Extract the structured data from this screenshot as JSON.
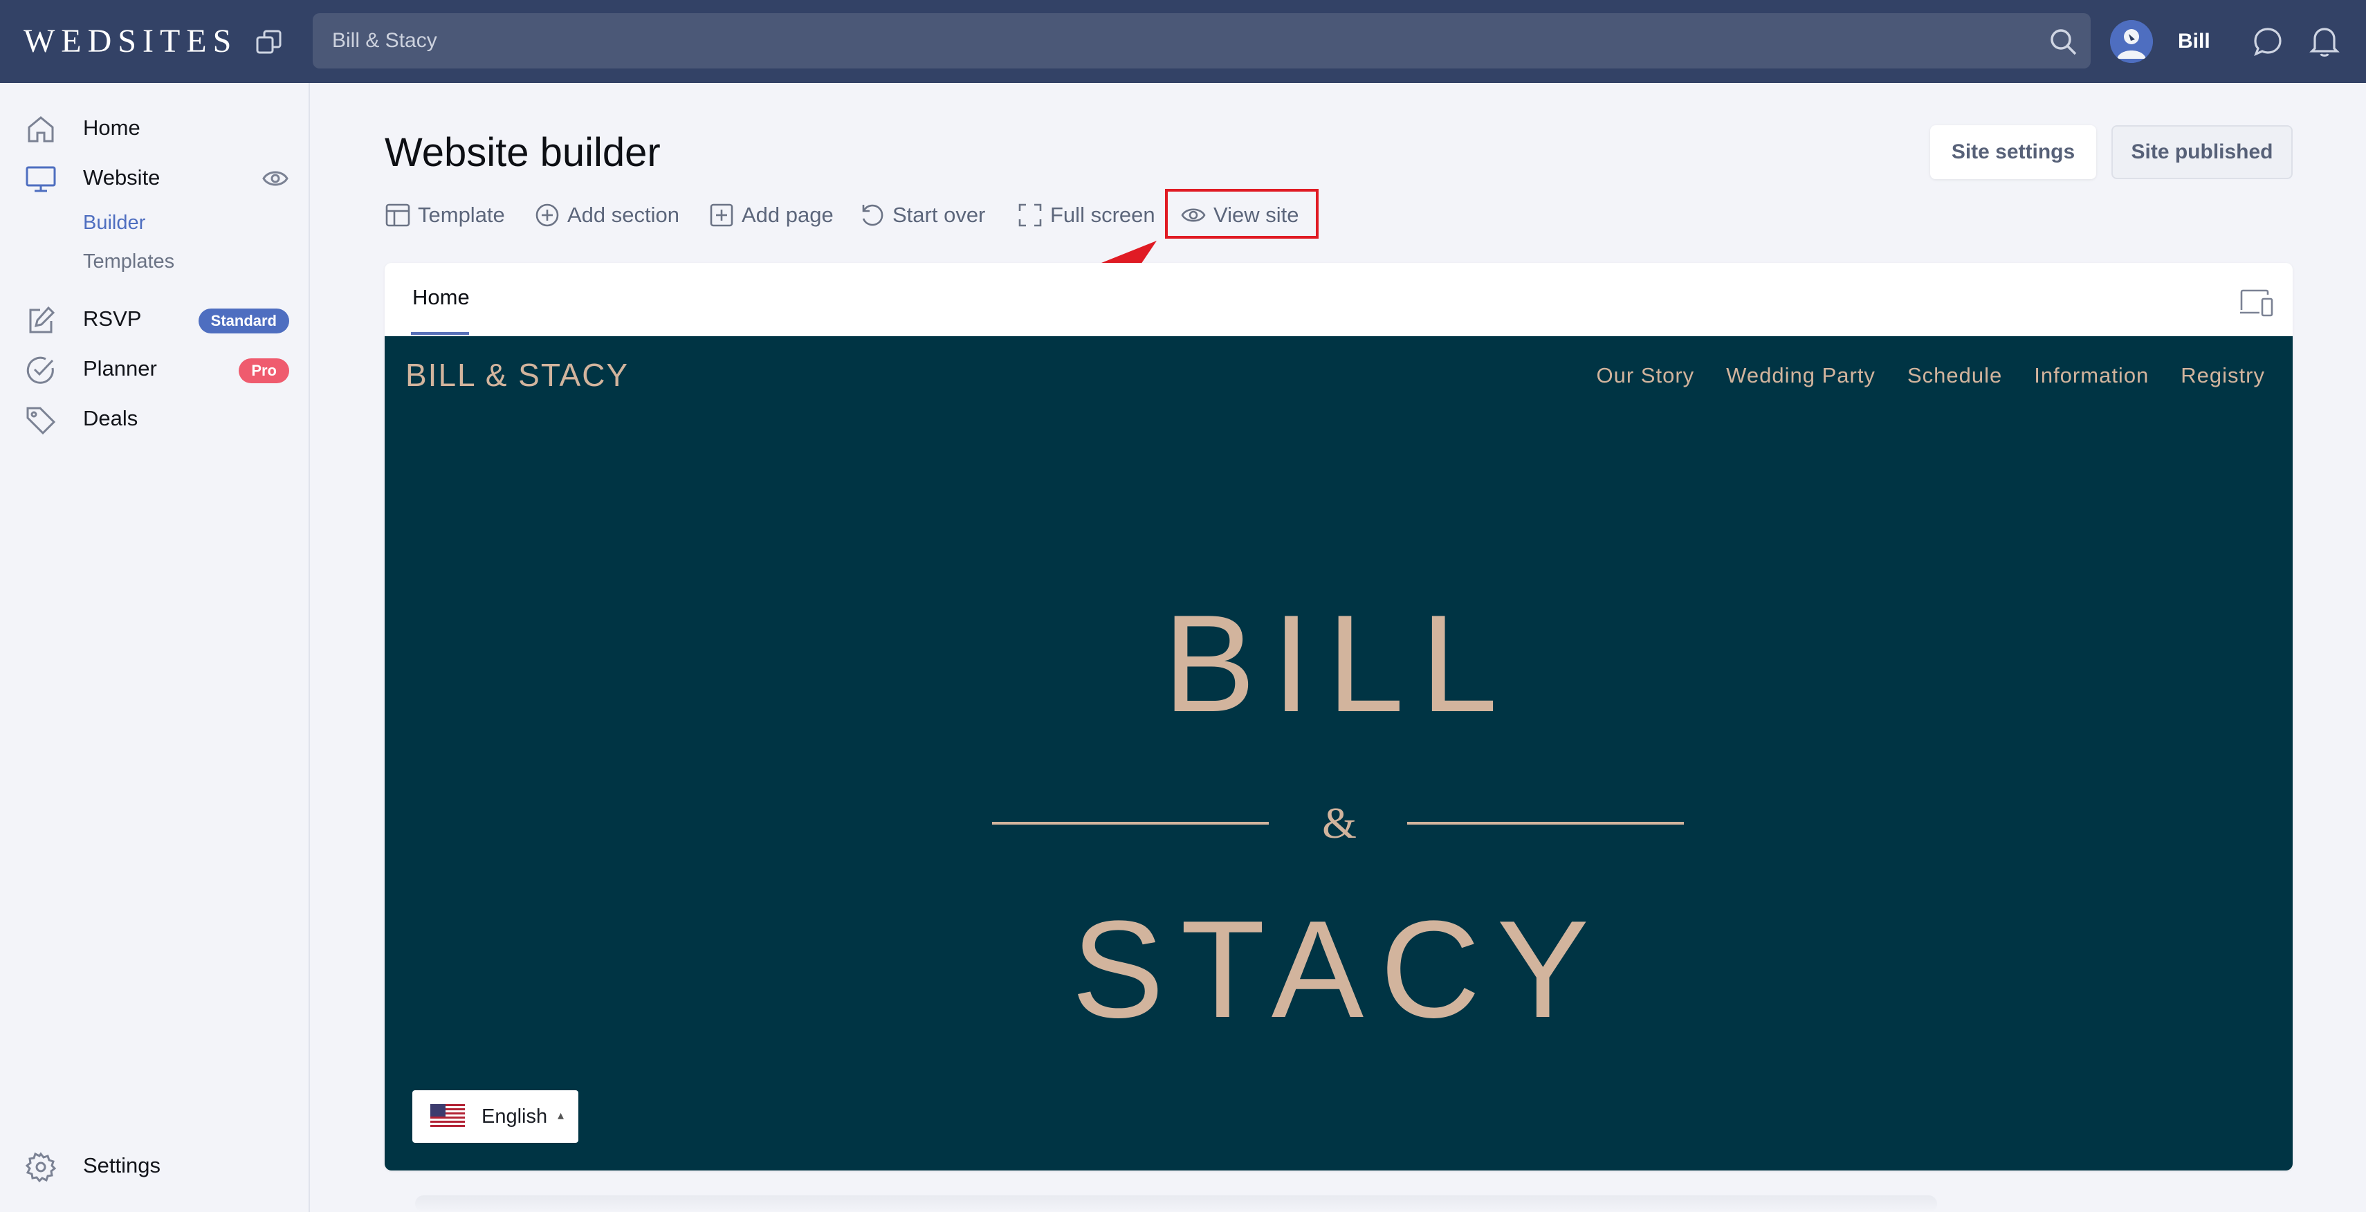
{
  "topbar": {
    "logo": "WEDSITES",
    "search_value": "Bill & Stacy",
    "user_name": "Bill"
  },
  "sidebar": {
    "items": [
      {
        "label": "Home",
        "icon": "home-icon"
      },
      {
        "label": "Website",
        "icon": "monitor-icon"
      },
      {
        "label": "RSVP",
        "icon": "edit-icon",
        "badge": "Standard"
      },
      {
        "label": "Planner",
        "icon": "check-circle-icon",
        "badge": "Pro"
      },
      {
        "label": "Deals",
        "icon": "tag-icon"
      }
    ],
    "website_sub": [
      {
        "label": "Builder"
      },
      {
        "label": "Templates"
      }
    ],
    "settings_label": "Settings"
  },
  "main": {
    "title": "Website builder",
    "site_settings_label": "Site settings",
    "site_published_label": "Site published",
    "toolbar": [
      {
        "label": "Template",
        "icon": "layout-icon"
      },
      {
        "label": "Add section",
        "icon": "plus-circle-icon"
      },
      {
        "label": "Add page",
        "icon": "plus-square-icon"
      },
      {
        "label": "Start over",
        "icon": "undo-icon"
      },
      {
        "label": "Full screen",
        "icon": "fullscreen-icon"
      },
      {
        "label": "View site",
        "icon": "eye-icon"
      }
    ],
    "page_tab": "Home"
  },
  "preview": {
    "logo": "BILL & STACY",
    "nav": [
      "Our Story",
      "Wedding Party",
      "Schedule",
      "Information",
      "Registry"
    ],
    "hero_top": "BILL",
    "hero_amp": "&",
    "hero_bottom": "STACY",
    "language": "English"
  },
  "colors": {
    "topbar": "#334266",
    "accent": "#4e6ec0",
    "preview_bg": "#003444",
    "preview_text": "#d2b49d",
    "badge_standard": "#4e6ec0",
    "badge_pro": "#ef5b6e",
    "highlight": "#e01b24"
  }
}
